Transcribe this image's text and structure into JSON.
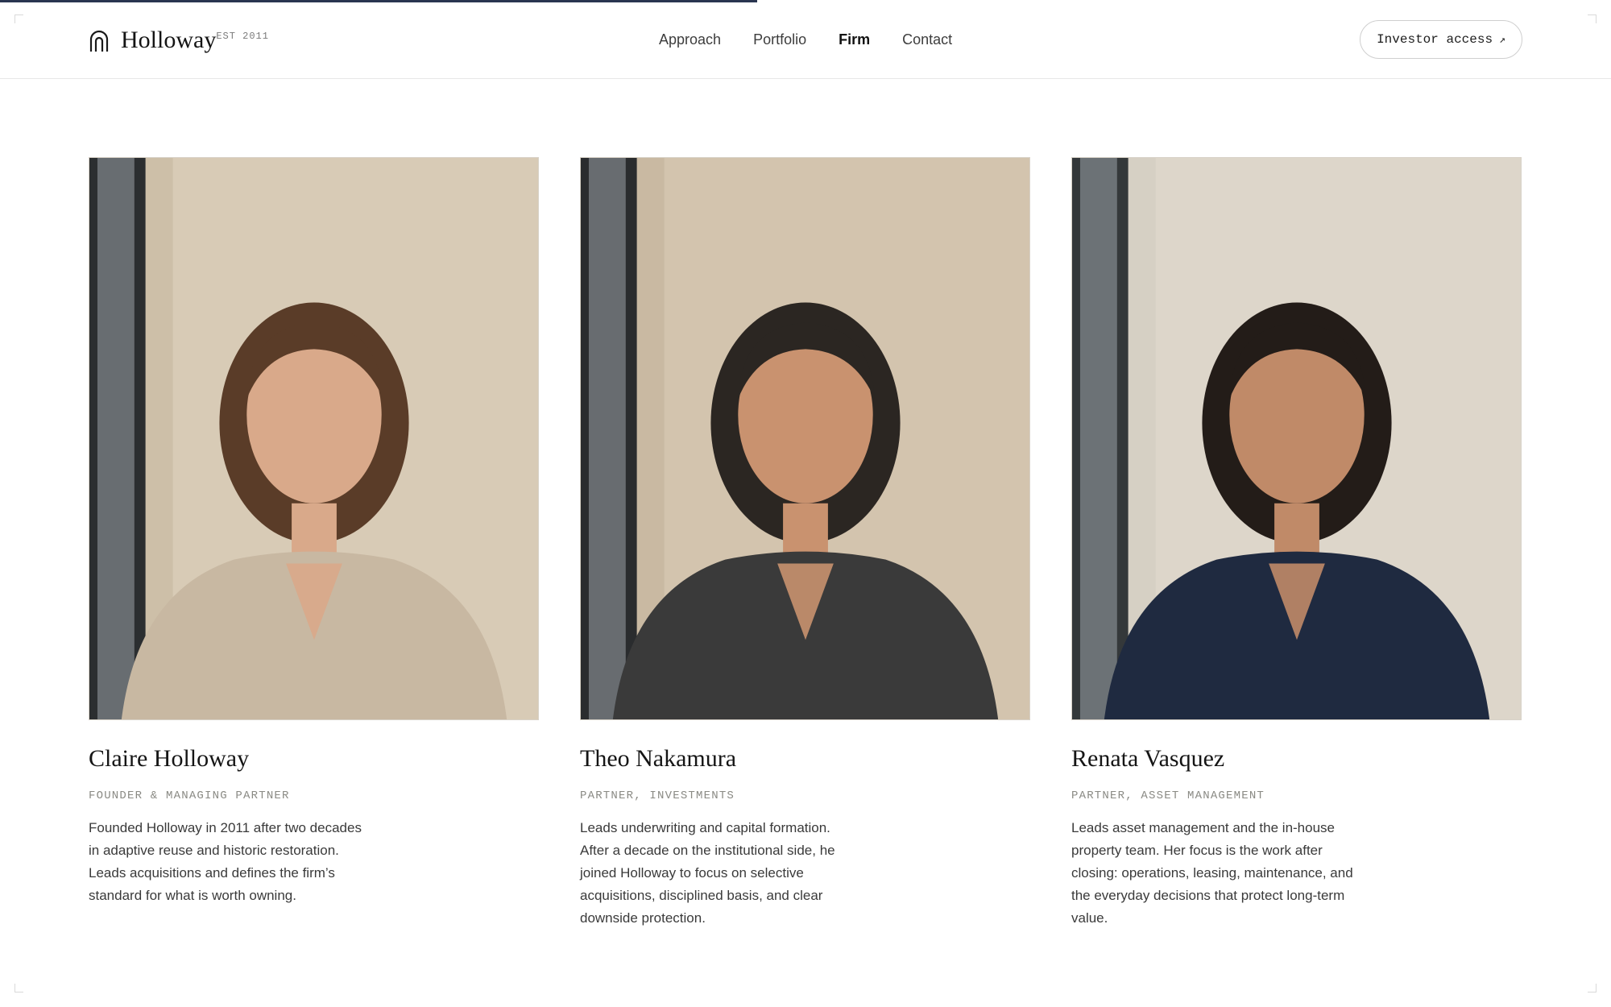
{
  "brand": {
    "name": "Holloway",
    "est": "EST 2011",
    "icon": "arch-icon"
  },
  "nav": {
    "items": [
      "Approach",
      "Portfolio",
      "Firm",
      "Contact"
    ],
    "active": "Firm"
  },
  "investor_button": {
    "label": "Investor access",
    "icon": "arrow-up-right-icon"
  },
  "scroll_progress": 0.47,
  "team": [
    {
      "name": "Claire Holloway",
      "role": "FOUNDER & MANAGING PARTNER",
      "bio": "Founded Holloway in 2011 after two decades in adaptive reuse and historic restoration. Leads acquisitions and defines the firm’s standard for what is worth owning.",
      "photo": {
        "icon": "portrait-photo",
        "palette": {
          "bg": "#cdbfa8",
          "wall": "#d8cbb6",
          "hair": "#5a3c28",
          "skin": "#d9a98a",
          "top": "#c8b8a2",
          "window": "#2b2e30"
        }
      }
    },
    {
      "name": "Theo Nakamura",
      "role": "PARTNER, INVESTMENTS",
      "bio": "Leads underwriting and capital formation. After a decade on the institutional side, he joined Holloway to focus on selective acquisitions, disciplined basis, and clear downside protection.",
      "photo": {
        "icon": "portrait-photo",
        "palette": {
          "bg": "#c9b9a2",
          "wall": "#d3c4ae",
          "hair": "#2b2622",
          "skin": "#c9926f",
          "top": "#3a3a3a",
          "window": "#2a2c2e"
        }
      }
    },
    {
      "name": "Renata Vasquez",
      "role": "PARTNER, ASSET MANAGEMENT",
      "bio": "Leads asset management and the in-house property team. Her focus is the work after closing: operations, leasing, maintenance, and the everyday decisions that protect long-term value.",
      "photo": {
        "icon": "portrait-photo",
        "palette": {
          "bg": "#d6d0c4",
          "wall": "#ddd6ca",
          "hair": "#231c18",
          "skin": "#c08a68",
          "top": "#1f2a40",
          "window": "#34383a"
        }
      }
    }
  ]
}
